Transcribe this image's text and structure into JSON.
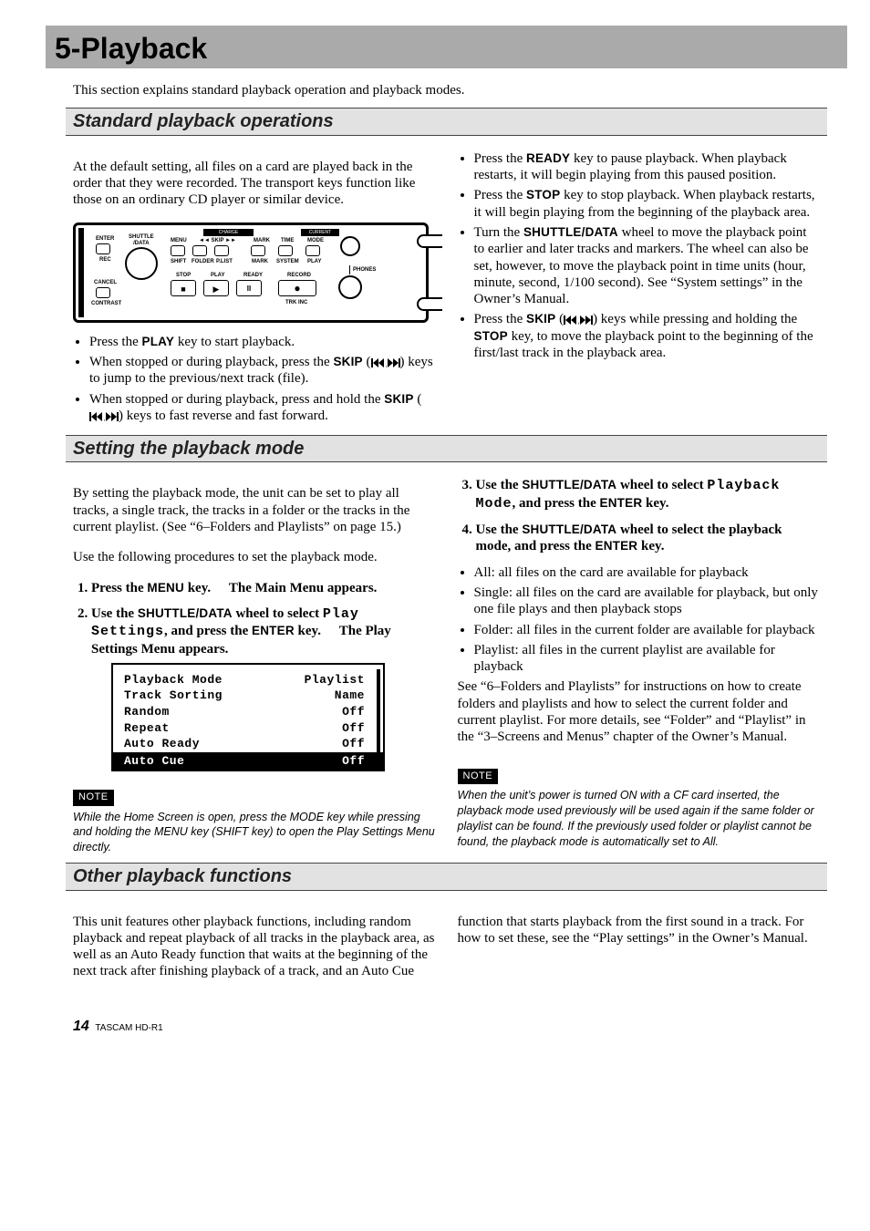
{
  "chapter_title": "5-Playback",
  "intro": "This section explains standard playback operation and playback modes.",
  "diagram": {
    "enter": "ENTER",
    "rec": "REC",
    "cancel": "CANCEL",
    "contrast": "CONTRAST",
    "shuttle": "SHUTTLE\n/DATA",
    "menu": "MENU",
    "skip_l": "◄◄",
    "skip_r": "►►",
    "skip": "SKIP",
    "mark": "MARK",
    "time": "TIME",
    "mode": "MODE",
    "shift": "SHIFT",
    "folder": "FOLDER",
    "plist": "P.LIST",
    "mark2": "MARK",
    "system": "SYSTEM",
    "play2": "PLAY",
    "stop": "STOP",
    "play": "PLAY",
    "ready": "READY",
    "record": "RECORD",
    "trk_inc": "TRK INC",
    "phones": "PHONES",
    "current": "CURRENT",
    "charge": "CHARGE"
  },
  "sec_standard": {
    "title": "Standard playback operations",
    "lead": "At the default setting, all files on a card are played back in the order that they were recorded. The transport keys function like those on an ordinary CD player or similar device.",
    "left": [
      {
        "p1": "Press the ",
        "k": "PLAY",
        "p2": " key to start playback."
      },
      {
        "p1": "When stopped or during playback, press the ",
        "k": "SKIP",
        "p2": " (",
        "icon": true,
        "p3": ") keys to jump to the previous/next track (file)."
      },
      {
        "p1": "When stopped or during playback, press and hold the ",
        "k": "SKIP",
        "p2": " (",
        "icon": true,
        "p3": ") keys to fast reverse and fast forward."
      }
    ],
    "right": [
      {
        "p1": "Press the ",
        "k": "READY",
        "p2": " key to pause playback. When playback restarts, it will begin playing from this paused position."
      },
      {
        "p1": "Press the ",
        "k": "STOP",
        "p2": " key to stop playback. When playback restarts, it will begin playing from the beginning of the playback area."
      },
      {
        "p1": "Turn the ",
        "k": "SHUTTLE/DATA",
        "p2": " wheel to move the playback point to earlier and later tracks and markers. The wheel can also be set, however, to move the playback point in time units (hour, minute, second, 1/100 second). See “System settings” in the Owner’s Manual."
      },
      {
        "p1": "Press the ",
        "k": "SKIP",
        "p2": " (",
        "icon": true,
        "p3": ") keys while pressing and holding the ",
        "k2": "STOP",
        "p4": " key, to move the playback point to the beginning of the first/last track in the playback area."
      }
    ]
  },
  "sec_mode": {
    "title": "Setting the playback mode",
    "lead": "By setting the playback mode, the unit can be set to play all tracks, a single track, the tracks in a folder or the tracks in the current playlist. (See “6–Folders and Playlists” on page 15.)",
    "lead2": "Use the following procedures to set the playback mode.",
    "step1": {
      "p1": "Press the ",
      "k": "MENU",
      "p2": " key.",
      "sub": "The Main Menu appears."
    },
    "step2": {
      "p1": "Use the ",
      "k": "SHUTTLE/DATA",
      "p2": " wheel to select ",
      "lcd": "Play Settings",
      "p3": ", and press the ",
      "k2": "ENTER",
      "p4": " key.",
      "sub": "The Play Settings Menu appears."
    },
    "lcd_rows": [
      {
        "l": "Playback Mode",
        "r": "Playlist"
      },
      {
        "l": "Track Sorting",
        "r": "Name"
      },
      {
        "l": "Random",
        "r": "Off"
      },
      {
        "l": "Repeat",
        "r": "Off"
      },
      {
        "l": "Auto Ready",
        "r": "Off"
      },
      {
        "l": "Auto Cue",
        "r": "Off",
        "sel": true
      }
    ],
    "note_label": "NOTE",
    "note_left": "While the Home Screen is open, press the MODE key while pressing and holding the MENU key (SHIFT key) to open the Play Settings Menu directly.",
    "step3": {
      "p1": "Use the ",
      "k": "SHUTTLE/DATA",
      "p2": " wheel to select ",
      "lcd": "Playback Mode",
      "p3": ", and press the ",
      "k2": "ENTER",
      "p4": " key."
    },
    "step4": {
      "p1": "Use the ",
      "k": "SHUTTLE/DATA",
      "p2": " wheel to select the playback mode, and press the ",
      "k2": "ENTER",
      "p3": " key."
    },
    "modes": [
      "All: all files on the card are available for playback",
      "Single: all files on the card are available for playback, but only one file plays and then playback stops",
      "Folder: all files in the current folder are available for playback",
      "Playlist: all files in the current playlist are available for playback"
    ],
    "after": "See “6–Folders and Playlists” for instructions on how to create folders and playlists and how to select the current folder and current playlist. For more details, see “Folder” and “Playlist” in the “3–Screens and Menus” chapter of the Owner’s Manual.",
    "note_right": "When the unit’s power is turned ON with a CF card inserted, the playback mode used previously will be used again if the same folder or playlist can be found. If the previously used folder or playlist cannot be found, the playback mode is automatically set to All."
  },
  "sec_other": {
    "title": "Other playback functions",
    "left": "This unit features other playback functions, including random playback and repeat playback of all tracks in the playback area, as well as an Auto Ready function that waits at the beginning of the next track after finishing playback of a track, and an Auto Cue",
    "right": "function that starts playback from the first sound in a track. For how to set these, see the “Play settings” in the Owner’s Manual."
  },
  "footer": {
    "page": "14",
    "product": "TASCAM  HD-R1"
  }
}
